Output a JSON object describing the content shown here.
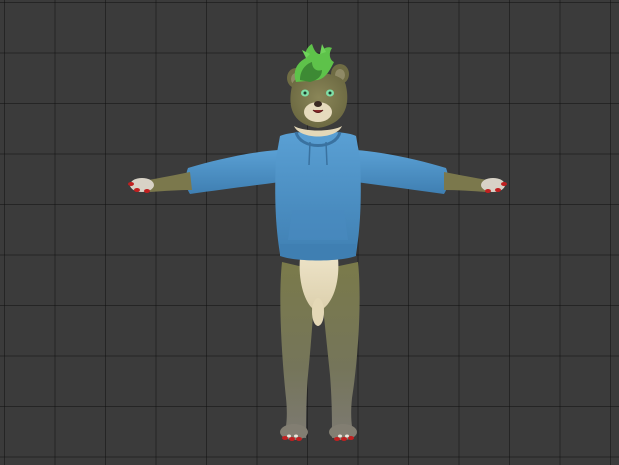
{
  "viewport": {
    "background_color": "#3b3b3b",
    "grid_line_color": "#1e1e1e",
    "grid_visible": true
  },
  "model": {
    "pose": "T-pose",
    "colors": {
      "fur": "#7d7a4e",
      "fur_dark": "#6b6842",
      "muzzle": "#e8dcc0",
      "belly": "#e6dbbd",
      "hair": "#5ec24a",
      "hair_dark": "#3d8a34",
      "hoodie": "#4f94c9",
      "hoodie_dark": "#3d7aab",
      "eyes": "#7fe0a8",
      "claws": "#c02020",
      "pads": "#ece6dc"
    }
  }
}
